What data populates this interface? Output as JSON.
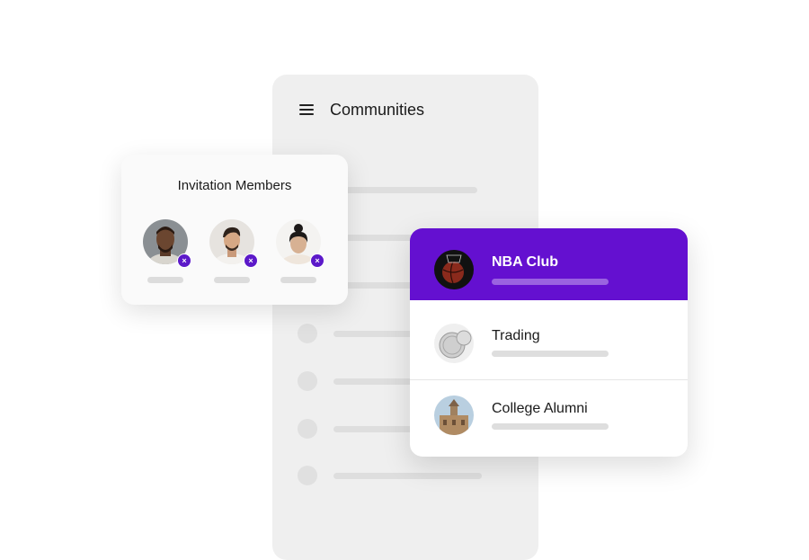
{
  "phone": {
    "title": "Communities",
    "menu_icon": "hamburger-icon"
  },
  "invite": {
    "title": "Invitation Members",
    "members": [
      {
        "avatar": "member-avatar-1",
        "remove_icon": "remove-icon"
      },
      {
        "avatar": "member-avatar-2",
        "remove_icon": "remove-icon"
      },
      {
        "avatar": "member-avatar-3",
        "remove_icon": "remove-icon"
      }
    ],
    "remove_glyph": "×"
  },
  "communities": [
    {
      "name": "NBA Club",
      "icon": "basketball-icon",
      "selected": true
    },
    {
      "name": "Trading",
      "icon": "coins-icon",
      "selected": false
    },
    {
      "name": "College Alumni",
      "icon": "building-icon",
      "selected": false
    }
  ],
  "colors": {
    "accent": "#6410d0",
    "badge": "#5c19c9",
    "panel": "#efefef"
  }
}
